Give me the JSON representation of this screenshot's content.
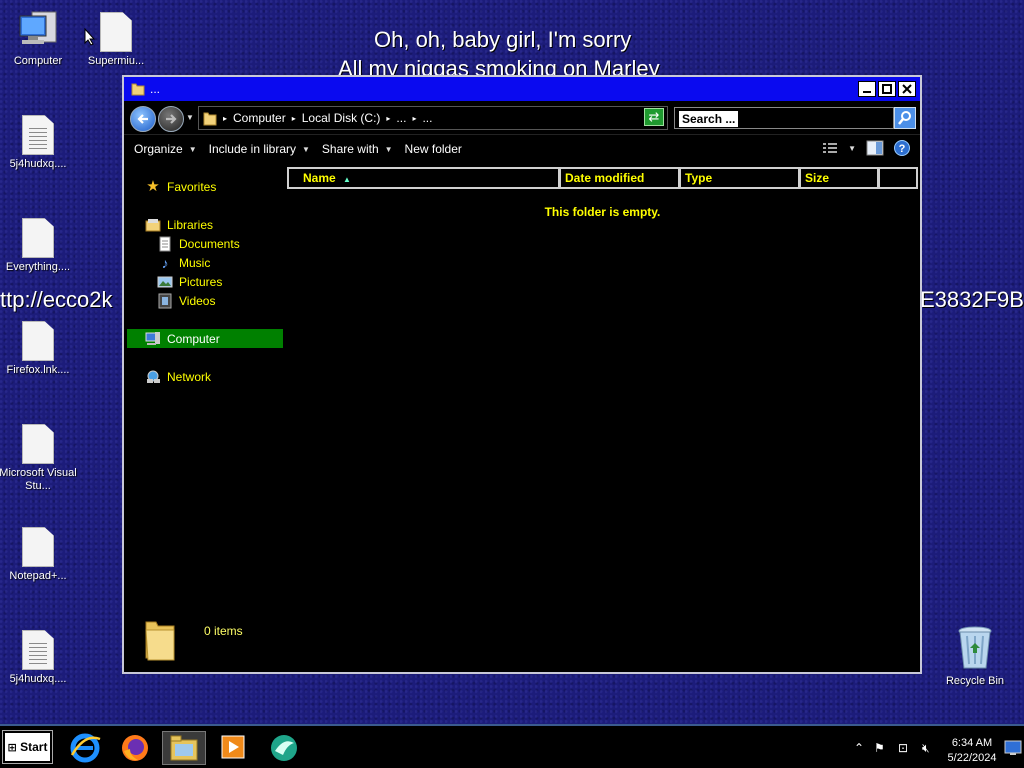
{
  "desktop": {
    "overlay_line1": "Oh, oh, baby girl, I'm sorry",
    "overlay_line2": "All my niggas smoking on Marley",
    "overlay_left": "ttp://ecco2k",
    "overlay_right": "E3832F9B",
    "icons": [
      {
        "label": "Computer",
        "icon": "computer-icon"
      },
      {
        "label": "Supermiu...",
        "icon": "file-icon"
      },
      {
        "label": "5j4hudxq....",
        "icon": "text-file-icon"
      },
      {
        "label": "Everything....",
        "icon": "file-icon"
      },
      {
        "label": "Firefox.lnk....",
        "icon": "file-icon"
      },
      {
        "label": "Microsoft Visual Stu...",
        "icon": "file-icon"
      },
      {
        "label": "Notepad+...",
        "icon": "file-icon"
      },
      {
        "label": "5j4hudxq....",
        "icon": "text-file-icon"
      },
      {
        "label": "Recycle Bin",
        "icon": "recycle-bin-icon"
      }
    ]
  },
  "window": {
    "title": "...",
    "address": {
      "crumbs": [
        "Computer",
        "Local Disk (C:)",
        "...",
        "..."
      ]
    },
    "search": {
      "placeholder": "Search ..."
    },
    "toolbar": {
      "organize": "Organize",
      "include_in_library": "Include in library",
      "share_with": "Share with",
      "new_folder": "New folder"
    },
    "nav": {
      "favorites": "Favorites",
      "libraries": "Libraries",
      "documents": "Documents",
      "music": "Music",
      "pictures": "Pictures",
      "videos": "Videos",
      "computer": "Computer",
      "network": "Network"
    },
    "columns": [
      "Name",
      "Date modified",
      "Type",
      "Size"
    ],
    "empty_message": "This folder is empty.",
    "item_count": "0 items"
  },
  "taskbar": {
    "start_label": "Start",
    "apps": [
      "internet-explorer-icon",
      "firefox-icon",
      "file-explorer-icon",
      "media-player-icon",
      "app-icon"
    ],
    "time": "6:34 AM",
    "date": "5/22/2024"
  },
  "colors": {
    "desktop_bg": "#1c1c7a",
    "titlebar": "#0a0af0",
    "nav_text": "#ffff00",
    "selected_nav": "#008000"
  }
}
